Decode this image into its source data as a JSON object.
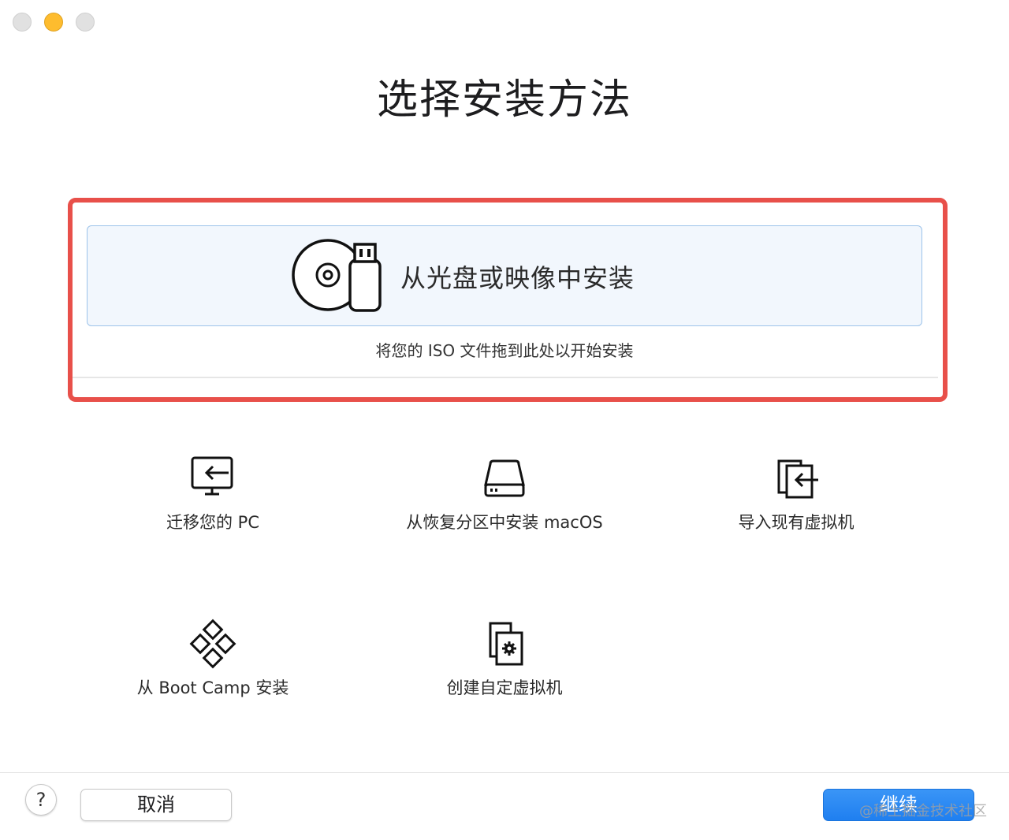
{
  "window": {
    "traffic_lights": [
      "close",
      "minimize",
      "zoom"
    ]
  },
  "title": "选择安装方法",
  "primary_option": {
    "label": "从光盘或映像中安装",
    "hint": "将您的 ISO 文件拖到此处以开始安装",
    "icon": "disc-usb-icon"
  },
  "options": [
    {
      "label": "迁移您的 PC",
      "icon": "migrate-pc-icon"
    },
    {
      "label": "从恢复分区中安装 macOS",
      "icon": "recovery-disk-icon"
    },
    {
      "label": "导入现有虚拟机",
      "icon": "import-vm-icon"
    },
    {
      "label": "从 Boot Camp 安装",
      "icon": "bootcamp-icon"
    },
    {
      "label": "创建自定虚拟机",
      "icon": "custom-vm-icon"
    }
  ],
  "footer": {
    "help_label": "?",
    "cancel_label": "取消",
    "continue_label": "继续"
  },
  "watermark": "@稀土掘金技术社区",
  "colors": {
    "highlight": "#e8504a",
    "accent": "#1f7ff0",
    "drop_zone_bg": "#f2f7fd"
  }
}
